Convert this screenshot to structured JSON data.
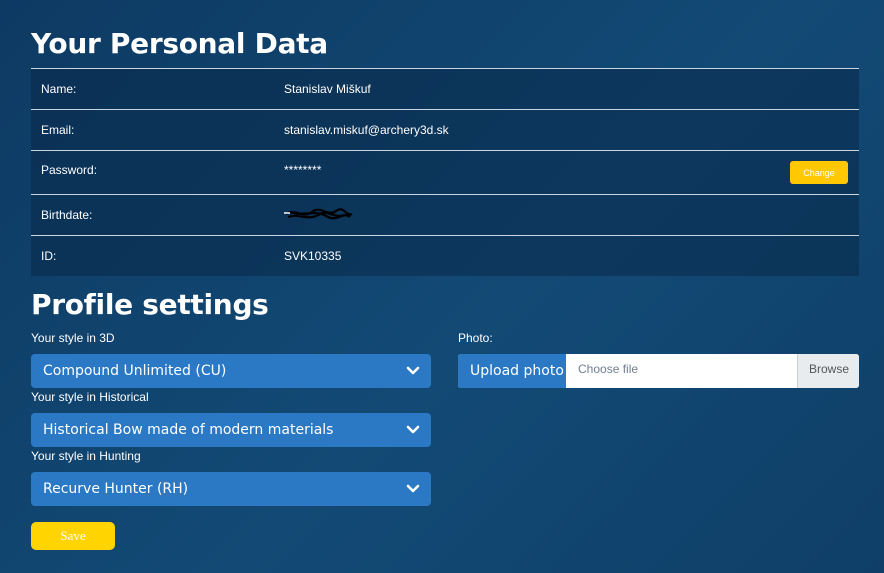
{
  "personal": {
    "title": "Your Personal Data",
    "rows": [
      {
        "label": "Name:",
        "value": "Stanislav Miškuf"
      },
      {
        "label": "Email:",
        "value": "stanislav.miskuf@archery3d.sk"
      },
      {
        "label": "Password:",
        "value": "********",
        "action": "Change"
      },
      {
        "label": "Birthdate:",
        "value": ""
      },
      {
        "label": "ID:",
        "value": "SVK10335"
      }
    ]
  },
  "profile": {
    "title": "Profile settings",
    "style_3d": {
      "label": "Your style in 3D",
      "selected": "Compound Unlimited (CU)"
    },
    "style_historical": {
      "label": "Your style in Historical",
      "selected": "Historical Bow made of modern materials"
    },
    "style_hunting": {
      "label": "Your style in Hunting",
      "selected": "Recurve Hunter (RH)"
    },
    "photo": {
      "label": "Photo:",
      "upload_label": "Upload photo",
      "placeholder": "Choose file",
      "browse": "Browse"
    },
    "save_label": "Save"
  },
  "colors": {
    "accent": "#ffc800",
    "select_bg": "#2b78c4"
  },
  "icons": {
    "dropdown": "chevron-down-icon"
  }
}
